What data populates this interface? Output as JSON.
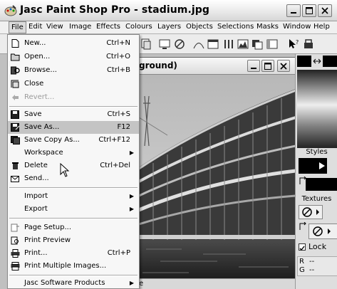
{
  "window": {
    "title": "Jasc Paint Shop Pro - stadium.jpg",
    "app_icon": "paint-palette-icon"
  },
  "menubar": [
    {
      "label": "File",
      "active": true
    },
    {
      "label": "Edit"
    },
    {
      "label": "View"
    },
    {
      "label": "Image"
    },
    {
      "label": "Effects"
    },
    {
      "label": "Colours"
    },
    {
      "label": "Layers"
    },
    {
      "label": "Objects"
    },
    {
      "label": "Selections"
    },
    {
      "label": "Masks"
    },
    {
      "label": "Window"
    },
    {
      "label": "Help"
    }
  ],
  "document": {
    "title": "ground)",
    "status_text": "e"
  },
  "palette": {
    "styles_label": "Styles",
    "textures_label": "Textures",
    "lock_label": "Lock",
    "r_label": "R",
    "r_value": "--",
    "g_label": "G",
    "g_value": "--"
  },
  "file_menu": {
    "items": [
      {
        "label": "New...",
        "shortcut": "Ctrl+N",
        "icon": "new-document-icon"
      },
      {
        "label": "Open...",
        "shortcut": "Ctrl+O",
        "icon": "open-folder-icon"
      },
      {
        "label": "Browse...",
        "shortcut": "Ctrl+B",
        "icon": "browse-icon"
      },
      {
        "label": "Close",
        "shortcut": "",
        "icon": "close-document-icon"
      },
      {
        "label": "Revert...",
        "shortcut": "",
        "icon": "revert-icon",
        "disabled": true
      },
      {
        "label": "Save",
        "shortcut": "Ctrl+S",
        "icon": "save-icon"
      },
      {
        "label": "Save As...",
        "shortcut": "F12",
        "icon": "save-as-icon",
        "highlighted": true
      },
      {
        "label": "Save Copy As...",
        "shortcut": "Ctrl+F12",
        "icon": "save-copy-icon"
      },
      {
        "label": "Workspace",
        "shortcut": "",
        "submenu": true
      },
      {
        "label": "Delete",
        "shortcut": "Ctrl+Del",
        "icon": "delete-icon"
      },
      {
        "label": "Send...",
        "shortcut": "",
        "icon": "send-mail-icon"
      },
      {
        "label": "Import",
        "shortcut": "",
        "submenu": true
      },
      {
        "label": "Export",
        "shortcut": "",
        "submenu": true
      },
      {
        "label": "Page Setup...",
        "shortcut": "",
        "icon": "page-setup-icon"
      },
      {
        "label": "Print Preview",
        "shortcut": "",
        "icon": "print-preview-icon"
      },
      {
        "label": "Print...",
        "shortcut": "Ctrl+P",
        "icon": "printer-icon"
      },
      {
        "label": "Print Multiple Images...",
        "shortcut": "",
        "icon": "print-multiple-icon"
      },
      {
        "label": "Jasc Software Products",
        "shortcut": "",
        "submenu": true
      }
    ]
  }
}
